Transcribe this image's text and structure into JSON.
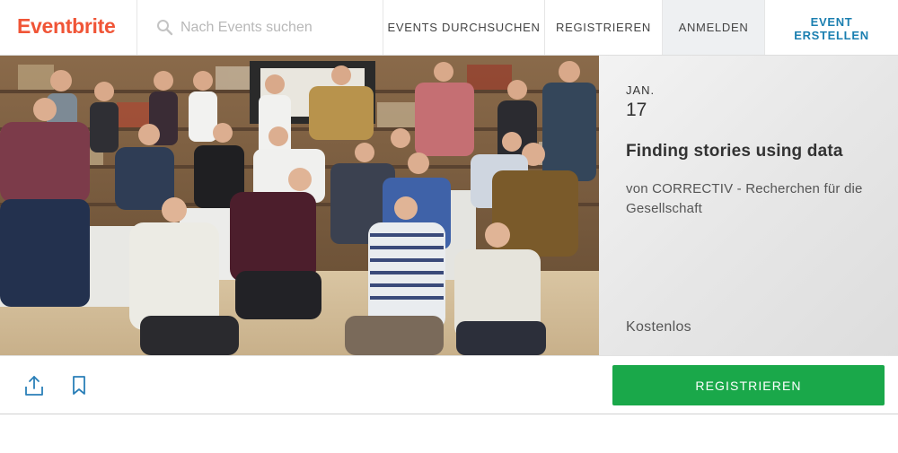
{
  "brand": {
    "logo_text": "Eventbrite",
    "accent_color": "#f05537"
  },
  "search": {
    "placeholder": "Nach Events suchen",
    "value": "",
    "icon": "search-icon"
  },
  "nav": {
    "browse_label": "EVENTS DURCHSUCHEN",
    "register_label": "REGISTRIEREN",
    "login_label": "ANMELDEN",
    "create_label": "EVENT ERSTELLEN",
    "create_color": "#1b7fb0"
  },
  "event": {
    "month": "JAN.",
    "day": "17",
    "title": "Finding stories using data",
    "organizer": "von CORRECTIV - Recherchen für die Gesellschaft",
    "price": "Kostenlos"
  },
  "actions": {
    "share_icon": "share-icon",
    "bookmark_icon": "bookmark-icon",
    "register_button_label": "REGISTRIEREN",
    "register_button_color": "#1aa84a"
  }
}
